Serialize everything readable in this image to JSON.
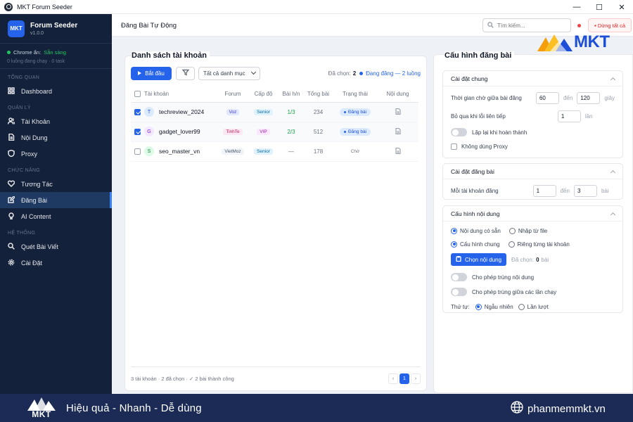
{
  "window": {
    "title": "MKT Forum Seeder",
    "controls": [
      "—",
      "☐",
      "✕"
    ]
  },
  "brand": {
    "logo": "MKT",
    "name": "Forum Seeder",
    "version": "v1.0.0"
  },
  "status": {
    "label": "Chrome ẩn:",
    "value": "Sẵn sàng",
    "sub": "0  luồng đang chạy ·  0  task"
  },
  "nav": {
    "section_overview": "TỔNG QUAN",
    "dashboard": "Dashboard",
    "section_manage": "QUẢN LÝ",
    "accounts": "Tài Khoản",
    "content": "Nội Dung",
    "proxy": "Proxy",
    "section_features": "CHỨC NĂNG",
    "interact": "Tương Tác",
    "post": "Đăng Bài",
    "ai": "AI Content",
    "section_system": "HỆ THỐNG",
    "scan": "Quét Bài Viết",
    "settings": "Cài Đặt"
  },
  "header": {
    "title": "Đăng Bài Tự Động",
    "search_placeholder": "Tìm kiếm...",
    "stop_all": "Dừng tất cả"
  },
  "watermark": {
    "text": "MKT"
  },
  "accounts_panel": {
    "title": "Danh sách tài khoản",
    "start": "Bắt đầu",
    "category": "Tất cả danh mục",
    "selected_label": "Đã chọn:",
    "selected_count": "2",
    "running": "Đang đăng — 2 luồng",
    "columns": [
      "Tài khoản",
      "Forum",
      "Cấp độ",
      "Bài h/n",
      "Tổng bài",
      "Trạng thái",
      "Nội dung"
    ],
    "rows": [
      {
        "initial": "T",
        "name": "techreview_2024",
        "forum": "Voz",
        "level": "Senior",
        "today": "1/3",
        "total": "234",
        "state": "Đăng bài",
        "checked": true
      },
      {
        "initial": "G",
        "name": "gadget_lover99",
        "forum": "TinhTe",
        "level": "VIP",
        "today": "2/3",
        "total": "512",
        "state": "Đăng bài",
        "checked": true
      },
      {
        "initial": "S",
        "name": "seo_master_vn",
        "forum": "VietMoz",
        "level": "Senior",
        "today": "—",
        "total": "178",
        "state": "Chờ",
        "checked": false
      }
    ],
    "footer": "3 tài khoản · 2 đã chọn · ✓ 2 bài thành công",
    "pager": {
      "prev": "‹",
      "page": "1",
      "next": "›"
    }
  },
  "config_panel": {
    "title": "Cấu hình đăng bài",
    "general": {
      "title": "Cài đặt chung",
      "wait_label": "Thời gian chờ giữa bài đăng",
      "wait_from": "60",
      "to": "đến",
      "wait_to": "120",
      "unit_sec": "giây",
      "skip_label": "Bỏ qua khi lỗi liên tiếp",
      "skip_value": "1",
      "unit_times": "lần",
      "repeat_label": "Lặp lại khi hoàn thành",
      "noproxy_label": "Không dùng Proxy"
    },
    "posting": {
      "title": "Cài đặt đăng bài",
      "per_account": "Mỗi tài khoản đăng",
      "from": "1",
      "to": "đến",
      "to_value": "3",
      "unit": "bài"
    },
    "content": {
      "title": "Cấu hình nội dung",
      "opt_available": "Nội dung có sẵn",
      "opt_import": "Nhập từ file",
      "opt_shared": "Cấu hình chung",
      "opt_per_account": "Riêng từng tài khoản",
      "choose": "Chọn nội dung",
      "chosen_label": "Đã chọn:",
      "chosen_count": "0",
      "chosen_unit": "bài",
      "dup_content": "Cho phép trùng nội dung",
      "dup_runs": "Cho phép trùng giữa các lần chạy",
      "order_label": "Thứ tự:",
      "order_random": "Ngẫu nhiên",
      "order_seq": "Lần lượt"
    }
  },
  "banner": {
    "logo": "MKT",
    "slogan": "Hiệu quả - Nhanh - Dễ dùng",
    "site": "phanmemmkt.vn"
  },
  "colors": {
    "sidebar": "#14213a",
    "accent": "#2563eb",
    "banner": "#1c2b55",
    "danger": "#dc2626",
    "success": "#16a34a"
  }
}
